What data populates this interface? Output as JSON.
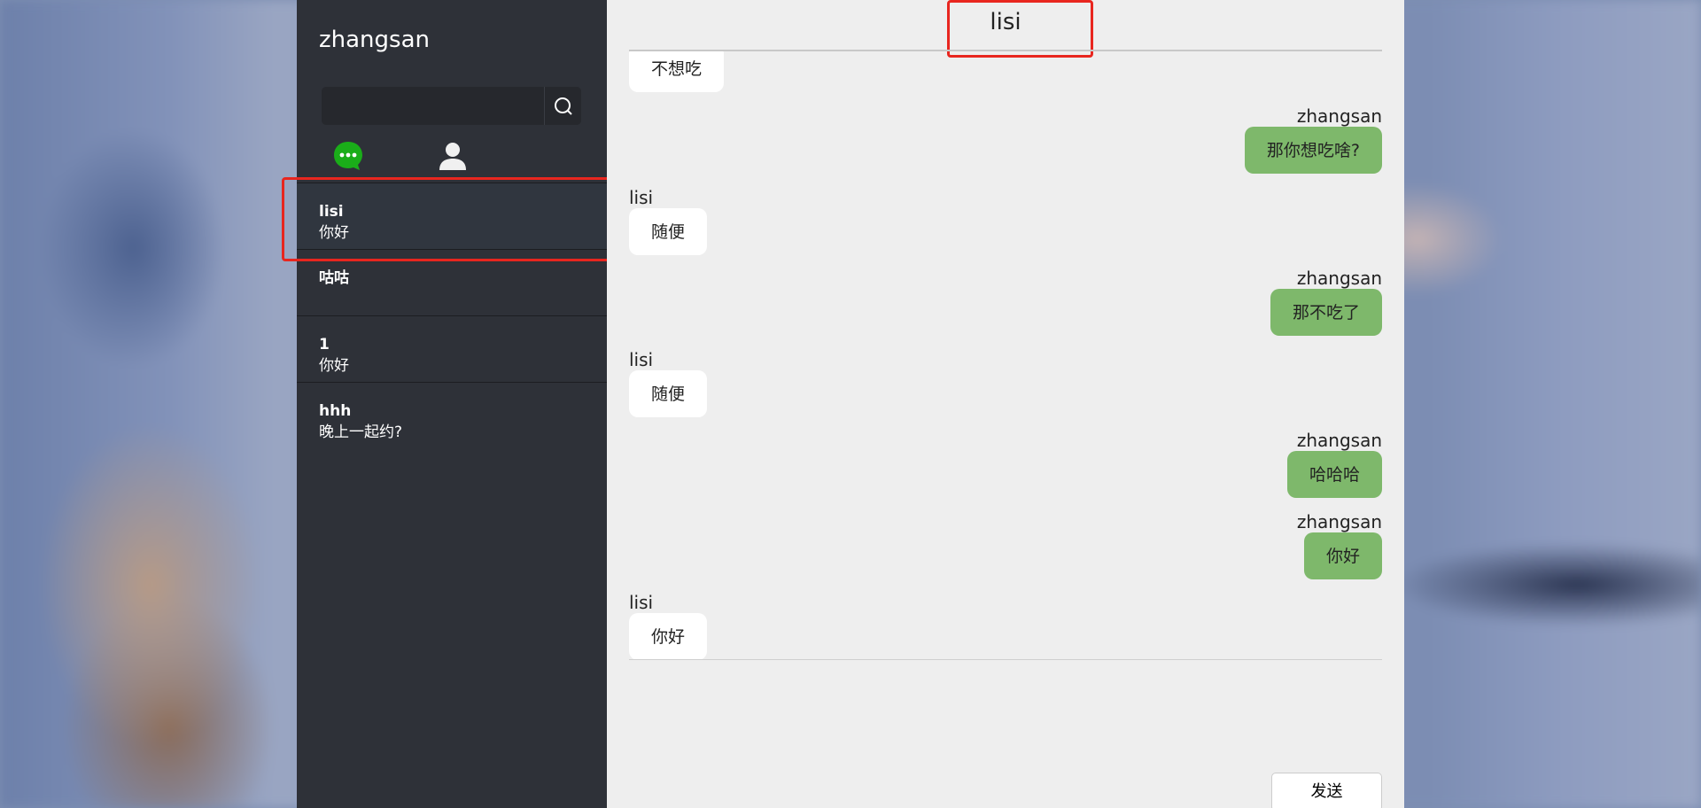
{
  "user": {
    "name": "zhangsan"
  },
  "search": {
    "placeholder": "",
    "value": ""
  },
  "tabs": [
    {
      "icon": "chat-bubble-icon",
      "color": "#1aad19"
    },
    {
      "icon": "user-icon",
      "color": "#ffffff"
    }
  ],
  "conversations": [
    {
      "name": "lisi",
      "last": "你好"
    },
    {
      "name": "咕咕",
      "last": ""
    },
    {
      "name": "1",
      "last": "你好"
    },
    {
      "name": "hhh",
      "last": "晚上一起约?"
    }
  ],
  "chat": {
    "title": "lisi",
    "messages": [
      {
        "from": "lisi",
        "side": "left",
        "text": "不想吃",
        "show_sender": false
      },
      {
        "from": "zhangsan",
        "side": "right",
        "text": "那你想吃啥?",
        "show_sender": true
      },
      {
        "from": "lisi",
        "side": "left",
        "text": "随便",
        "show_sender": true
      },
      {
        "from": "zhangsan",
        "side": "right",
        "text": "那不吃了",
        "show_sender": true
      },
      {
        "from": "lisi",
        "side": "left",
        "text": "随便",
        "show_sender": true
      },
      {
        "from": "zhangsan",
        "side": "right",
        "text": "哈哈哈",
        "show_sender": true
      },
      {
        "from": "zhangsan",
        "side": "right",
        "text": "你好",
        "show_sender": true
      },
      {
        "from": "lisi",
        "side": "left",
        "text": "你好",
        "show_sender": true
      }
    ],
    "send_label": "发送"
  },
  "colors": {
    "sidebar": "#2e3138",
    "chat_bg": "#eeeeee",
    "bubble_self": "#7eb86b",
    "bubble_other": "#ffffff",
    "highlight": "#e8261f"
  }
}
